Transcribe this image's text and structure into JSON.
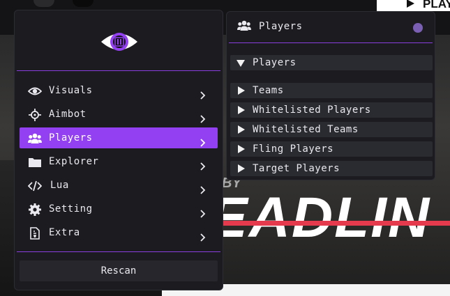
{
  "background": {
    "play_button": "PLAY",
    "game_title_fragment": "EADLIN",
    "small_fragment": "BY"
  },
  "main_menu": {
    "logo": "eye-logo-icon",
    "items": [
      {
        "label": "Visuals",
        "icon": "eye-icon"
      },
      {
        "label": "Aimbot",
        "icon": "crosshair-icon"
      },
      {
        "label": "Players",
        "icon": "users-icon"
      },
      {
        "label": "Explorer",
        "icon": "folder-icon"
      },
      {
        "label": "Lua",
        "icon": "code-icon"
      },
      {
        "label": "Setting",
        "icon": "gear-icon"
      },
      {
        "label": "Extra",
        "icon": "file-icon"
      }
    ],
    "active_item": "Players",
    "rescan_label": "Rescan"
  },
  "players_panel": {
    "title": "Players",
    "icon": "users-icon",
    "expanded_section": "Players",
    "sections": [
      "Teams",
      "Whitelisted Players",
      "Whitelisted Teams",
      "Fling Players",
      "Target Players"
    ]
  },
  "colors": {
    "accent": "#9340f3",
    "panel_bg": "#1c1c20",
    "section_bg": "#2a2a31",
    "status_dot": "#7a5fb4"
  }
}
